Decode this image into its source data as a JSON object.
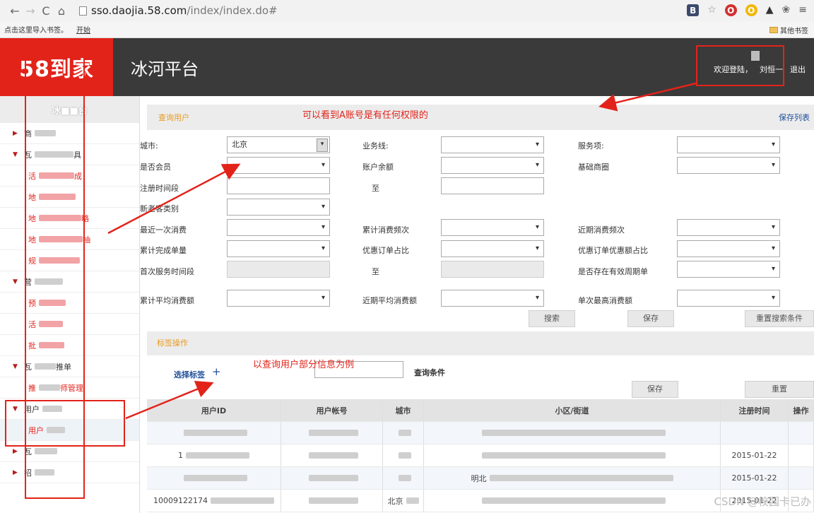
{
  "browser": {
    "url_host": "sso.daojia.58.com",
    "url_path": "/index/index.do#",
    "bookmarks": [
      "点击这里导入书签。",
      "开始"
    ],
    "other_bookmarks": "其他书签"
  },
  "header": {
    "logo": "58到家",
    "title": "冰河平台",
    "welcome": "欢迎登陆，",
    "username": "刘恒一",
    "logout": "退出"
  },
  "sidebar": {
    "head": "冰■■台",
    "items": [
      {
        "label": "商",
        "type": "group"
      },
      {
        "label": "瓦",
        "suffix": "具",
        "type": "group"
      },
      {
        "label": "活",
        "suffix": "成",
        "type": "child"
      },
      {
        "label": "地",
        "type": "child"
      },
      {
        "label": "地",
        "suffix": "略",
        "type": "child"
      },
      {
        "label": "地",
        "suffix": "抽",
        "type": "child"
      },
      {
        "label": "规",
        "type": "child"
      },
      {
        "label": "营",
        "type": "group"
      },
      {
        "label": "预",
        "type": "child"
      },
      {
        "label": "活",
        "type": "child"
      },
      {
        "label": "批",
        "type": "child"
      },
      {
        "label": "瓦",
        "suffix": "推单",
        "type": "group"
      },
      {
        "label": "推",
        "suffix": "师管理",
        "type": "child"
      },
      {
        "label": "用户",
        "type": "group"
      },
      {
        "label": "用户",
        "type": "child"
      },
      {
        "label": "瓦",
        "type": "group"
      },
      {
        "label": "招",
        "type": "group"
      }
    ]
  },
  "query": {
    "section_title": "查询用户",
    "save_list": "保存列表",
    "fields": {
      "city_label": "城市:",
      "city_value": "北京",
      "business_label": "业务线:",
      "service_label": "服务项:",
      "member_label": "是否会员",
      "balance_label": "账户余额",
      "base_area_label": "基础商圈",
      "reg_period_label": "注册时间段",
      "to_label": "至",
      "newold_label": "新老客类别",
      "last_consume_label": "最近一次消费",
      "total_freq_label": "累计消费频次",
      "recent_freq_label": "近期消费频次",
      "total_orders_label": "累计完成单量",
      "coupon_ratio_label": "优惠订单占比",
      "coupon_amount_label": "优惠订单优惠额占比",
      "first_service_label": "首次服务时间段",
      "periodic_label": "是否存在有效周期单",
      "avg_consume_label": "累计平均消费额",
      "recent_avg_label": "近期平均消费额",
      "single_max_label": "单次最高消费额"
    },
    "buttons": {
      "search": "搜索",
      "save": "保存",
      "reset": "重置搜索条件"
    }
  },
  "tags": {
    "section_title": "标签操作",
    "select_tag": "选择标签",
    "plus": "+",
    "query_conditions": "查询条件",
    "save": "保存",
    "reset": "重置"
  },
  "table": {
    "headers": [
      "用户ID",
      "用户帐号",
      "城市",
      "小区/街道",
      "注册时间",
      "操作"
    ],
    "rows": [
      [
        "",
        "",
        "",
        "",
        ""
      ],
      [
        "1",
        "",
        "",
        "",
        "2015-01-22"
      ],
      [
        "",
        "",
        "",
        "明北",
        "2015-01-22"
      ],
      [
        "10009122174",
        "",
        "北京",
        "",
        "2015-01-22"
      ]
    ]
  },
  "annotations": {
    "top": "可以看到A账号是有任何权限的",
    "middle": "以查询用户部分信息为例"
  },
  "watermark": "CSDN @校园卡已办",
  "colors": {
    "brand_red": "#e2231a",
    "header_dark": "#3a3a3a",
    "section_orange": "#e89a1e",
    "link_blue": "#1f4e9a"
  }
}
